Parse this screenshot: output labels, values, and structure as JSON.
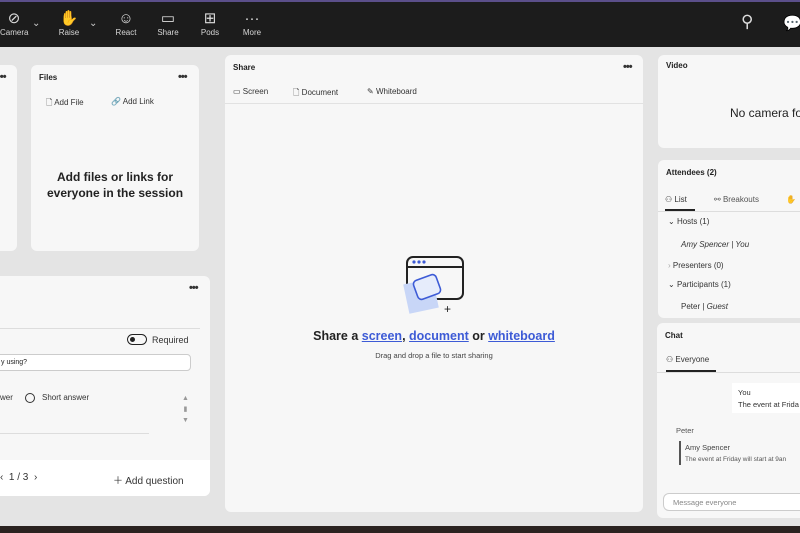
{
  "toolbar": {
    "items": [
      {
        "label": "Camera",
        "icon": "camera-off-icon"
      },
      {
        "label": "Raise",
        "icon": "hand-icon"
      },
      {
        "label": "React",
        "icon": "smile-icon"
      },
      {
        "label": "Share",
        "icon": "monitor-icon"
      },
      {
        "label": "Pods",
        "icon": "grid-icon"
      },
      {
        "label": "More",
        "icon": "more-icon"
      }
    ]
  },
  "files": {
    "title": "Files",
    "add_file": "Add File",
    "add_link": "Add Link",
    "empty": "Add files or links for everyone in the session"
  },
  "poll": {
    "required": "Required",
    "question": "y using?",
    "option_a": "wer",
    "option_b": "Short answer",
    "page": "1 / 3",
    "add_question": "Add question"
  },
  "share": {
    "title": "Share",
    "tabs": [
      "Screen",
      "Document",
      "Whiteboard"
    ],
    "headline_prefix": "Share a ",
    "link_screen": "screen",
    "sep": ", ",
    "link_document": "document",
    "or": " or ",
    "link_whiteboard": "whiteboard",
    "hint": "Drag and drop a file to start sharing"
  },
  "video": {
    "title": "Video",
    "message": "No camera fo"
  },
  "attendees": {
    "title": "Attendees (2)",
    "tabs": [
      "List",
      "Breakouts"
    ],
    "groups": [
      {
        "label": "Hosts (1)",
        "expanded": true
      },
      {
        "label": "Presenters (0)",
        "expanded": false
      },
      {
        "label": "Participants (1)",
        "expanded": true
      }
    ],
    "host": "Amy Spencer | You",
    "participant_name": "Peter | ",
    "participant_role": "Guest"
  },
  "chat": {
    "title": "Chat",
    "tab": "Everyone",
    "msg1_sender": "You",
    "msg1_text": "The event at Frida",
    "msg2_sender": "Peter",
    "quote_sender": "Amy Spencer",
    "quote_text": "The event at Friday will start at 9an",
    "placeholder": "Message everyone"
  },
  "colors": {
    "accent": "#3d5bd6",
    "topbar": "#1c1c1c"
  }
}
